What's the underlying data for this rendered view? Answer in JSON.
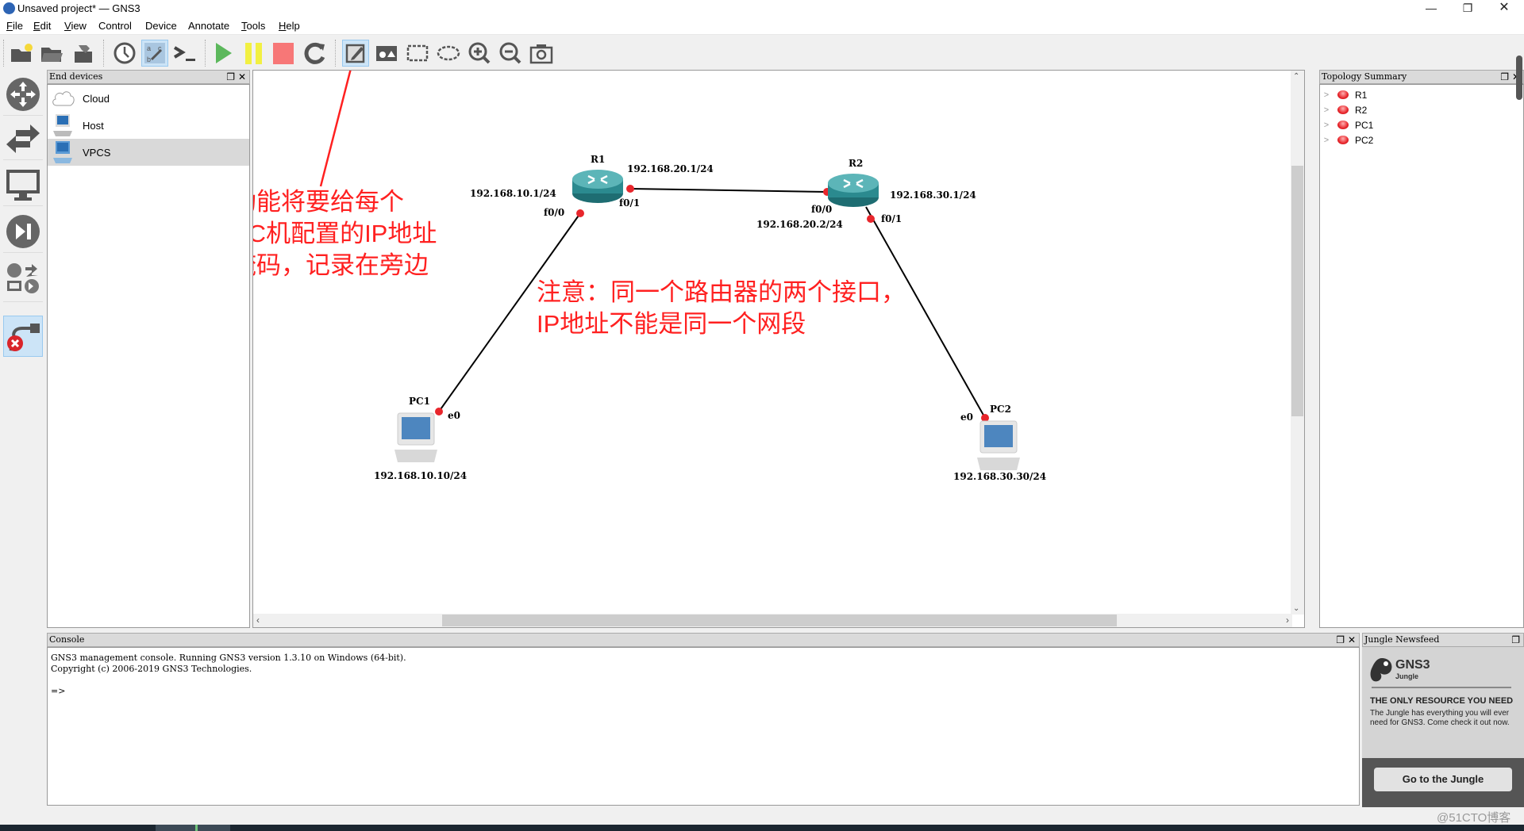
{
  "window": {
    "title": "Unsaved project* — GNS3",
    "controls": [
      "minimize",
      "restore",
      "close"
    ]
  },
  "menu": [
    {
      "label": "File",
      "mnemonic": "F",
      "rest": "ile"
    },
    {
      "label": "Edit",
      "mnemonic": "E",
      "rest": "dit"
    },
    {
      "label": "View",
      "mnemonic": "V",
      "rest": "iew"
    },
    {
      "label": "Control",
      "mnemonic": "",
      "rest": "Control"
    },
    {
      "label": "Device",
      "mnemonic": "",
      "rest": "Device"
    },
    {
      "label": "Annotate",
      "mnemonic": "",
      "rest": "Annotate"
    },
    {
      "label": "Tools",
      "mnemonic": "T",
      "rest": "ools"
    },
    {
      "label": "Help",
      "mnemonic": "H",
      "rest": "elp"
    }
  ],
  "toolbar": {
    "buttons": [
      {
        "name": "new-project",
        "icon": "folder-new-icon"
      },
      {
        "name": "open-project",
        "icon": "folder-open-icon"
      },
      {
        "name": "save-project",
        "icon": "save-icon"
      },
      {
        "name": "snapshot",
        "icon": "clock-icon"
      },
      {
        "name": "show-interface-labels",
        "icon": "interface-labels-icon",
        "active": true
      },
      {
        "name": "console-all",
        "icon": "terminal-icon"
      },
      {
        "name": "start-all",
        "icon": "play-icon"
      },
      {
        "name": "suspend-all",
        "icon": "pause-icon"
      },
      {
        "name": "stop-all",
        "icon": "stop-icon"
      },
      {
        "name": "reload-all",
        "icon": "reload-icon"
      },
      {
        "name": "add-note",
        "icon": "note-edit-icon",
        "active": true
      },
      {
        "name": "insert-picture",
        "icon": "picture-icon"
      },
      {
        "name": "draw-rectangle",
        "icon": "rectangle-icon"
      },
      {
        "name": "draw-ellipse",
        "icon": "ellipse-icon"
      },
      {
        "name": "zoom-in",
        "icon": "zoom-in-icon"
      },
      {
        "name": "zoom-out",
        "icon": "zoom-out-icon"
      },
      {
        "name": "screenshot",
        "icon": "camera-icon"
      }
    ]
  },
  "devbar": {
    "buttons": [
      {
        "name": "routers",
        "icon": "router-icon"
      },
      {
        "name": "switches",
        "icon": "switch-icon"
      },
      {
        "name": "end-devices",
        "icon": "monitor-icon"
      },
      {
        "name": "security-devices",
        "icon": "security-icon"
      },
      {
        "name": "all-devices",
        "icon": "all-devices-icon"
      },
      {
        "name": "add-link",
        "icon": "add-link-icon",
        "active": true
      }
    ]
  },
  "end_devices": {
    "title": "End devices",
    "items": [
      {
        "label": "Cloud",
        "icon": "cloud-icon"
      },
      {
        "label": "Host",
        "icon": "host-icon"
      },
      {
        "label": "VPCS",
        "icon": "vpcs-icon",
        "selected": true
      }
    ]
  },
  "topology": {
    "nodes": [
      {
        "id": "R1",
        "label": "R1",
        "type": "router"
      },
      {
        "id": "R2",
        "label": "R2",
        "type": "router"
      },
      {
        "id": "PC1",
        "label": "PC1",
        "type": "pc"
      },
      {
        "id": "PC2",
        "label": "PC2",
        "type": "pc"
      }
    ],
    "links": [
      {
        "from": "R1",
        "to": "PC1",
        "from_port": "f0/0",
        "to_port": "e0"
      },
      {
        "from": "R1",
        "to": "R2",
        "from_port": "f0/1",
        "to_port": "f0/0"
      },
      {
        "from": "R2",
        "to": "PC2",
        "from_port": "f0/1",
        "to_port": "e0"
      }
    ],
    "port_labels": {
      "r1_f00": "f0/0",
      "r1_f01": "f0/1",
      "r2_f00": "f0/0",
      "r2_f01": "f0/1",
      "pc1_e0": "e0",
      "pc2_e0": "e0"
    },
    "ip_labels": {
      "r1_f00": "192.168.10.1/24",
      "r1_f01": "192.168.20.1/24",
      "r2_f00": "192.168.20.2/24",
      "r2_f01": "192.168.30.1/24",
      "pc1": "192.168.10.10/24",
      "pc2": "192.168.30.30/24"
    },
    "notes": {
      "left_lines": [
        "用笔记功能将要给每个",
        "接口和PC机配置的IP地址",
        "和子网掩码，记录在旁边"
      ],
      "center_lines": [
        "注意：同一个路由器的两个接口，",
        "IP地址不能是同一个网段"
      ]
    },
    "colors": {
      "note": "#ff2020",
      "port_dot": "#e8262c",
      "link": "#000000"
    }
  },
  "topology_summary": {
    "title": "Topology Summary",
    "items": [
      {
        "label": "R1",
        "status": "stopped"
      },
      {
        "label": "R2",
        "status": "stopped"
      },
      {
        "label": "PC1",
        "status": "stopped"
      },
      {
        "label": "PC2",
        "status": "stopped"
      }
    ]
  },
  "console": {
    "title": "Console",
    "lines": [
      "GNS3 management console. Running GNS3 version 1.3.10 on Windows (64-bit).",
      "Copyright (c) 2006-2019 GNS3 Technologies.",
      "",
      "=>"
    ]
  },
  "jungle": {
    "title": "Jungle Newsfeed",
    "logo_title": "GNS3",
    "logo_sub": "Jungle",
    "headline": "THE ONLY RESOURCE YOU NEED",
    "body": "The Jungle has everything you will ever need for GNS3. Come check it out now.",
    "button": "Go to the Jungle"
  },
  "watermark": "@51CTO博客"
}
